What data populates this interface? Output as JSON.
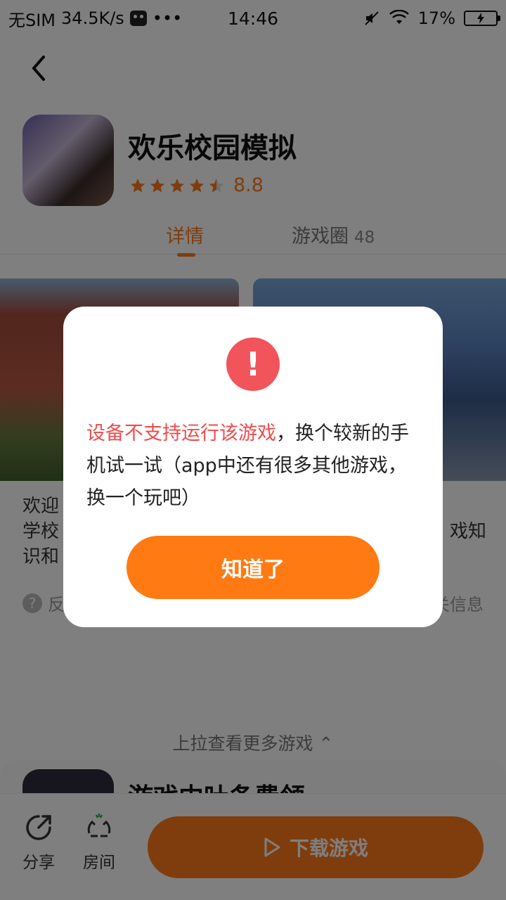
{
  "status_bar": {
    "carrier": "无SIM",
    "speed": "34.5K/s",
    "dots": "•••",
    "time": "14:46",
    "battery": "17%"
  },
  "app": {
    "title": "欢乐校园模拟",
    "rating": "8.8",
    "rating_stars": 4.5
  },
  "tabs": {
    "details": "详情",
    "circle": "游戏圈",
    "circle_count": "48"
  },
  "description": {
    "line1": "欢迎",
    "line2_left": "学校",
    "line2_right": "戏知",
    "line3": "识和"
  },
  "feedback": {
    "left": "反",
    "right": "关信息"
  },
  "pull_more": "上拉查看更多游戏",
  "next_game_title": "游戏中吐条费领",
  "bottom_bar": {
    "share": "分享",
    "room": "房间",
    "download": "下载游戏"
  },
  "modal": {
    "highlight": "设备不支持运行该游戏",
    "message_rest": "，换个较新的手机试一试（app中还有很多其他游戏，换一个玩吧）",
    "ok_label": "知道了"
  },
  "colors": {
    "accent": "#ff7a1a",
    "alert": "#f2545b",
    "highlight_text": "#ef4b4b"
  }
}
